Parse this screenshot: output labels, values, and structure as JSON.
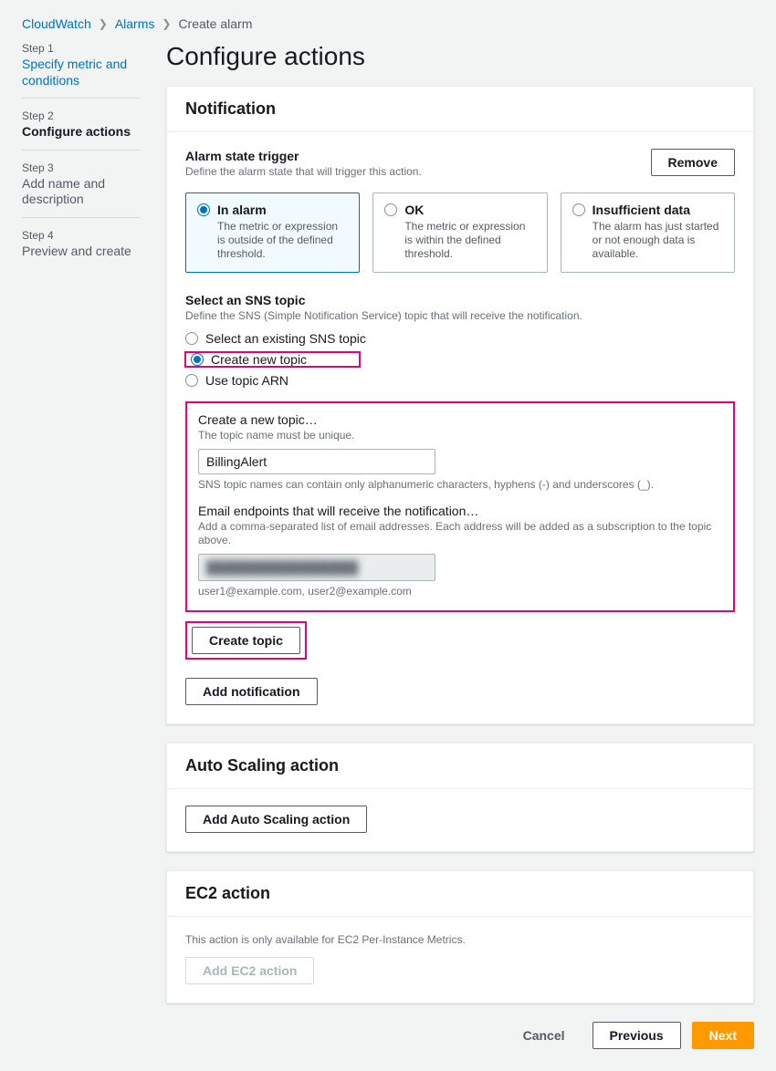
{
  "breadcrumbs": {
    "items": [
      "CloudWatch",
      "Alarms"
    ],
    "current": "Create alarm"
  },
  "sidebar": {
    "steps": [
      {
        "num": "Step 1",
        "name": "Specify metric and conditions"
      },
      {
        "num": "Step 2",
        "name": "Configure actions"
      },
      {
        "num": "Step 3",
        "name": "Add name and description"
      },
      {
        "num": "Step 4",
        "name": "Preview and create"
      }
    ]
  },
  "page": {
    "title": "Configure actions"
  },
  "notification": {
    "title": "Notification",
    "remove_label": "Remove",
    "trigger": {
      "title": "Alarm state trigger",
      "help": "Define the alarm state that will trigger this action.",
      "options": [
        {
          "label": "In alarm",
          "desc": "The metric or expression is outside of the defined threshold."
        },
        {
          "label": "OK",
          "desc": "The metric or expression is within the defined threshold."
        },
        {
          "label": "Insufficient data",
          "desc": "The alarm has just started or not enough data is available."
        }
      ]
    },
    "sns": {
      "title": "Select an SNS topic",
      "help": "Define the SNS (Simple Notification Service) topic that will receive the notification.",
      "options": [
        "Select an existing SNS topic",
        "Create new topic",
        "Use topic ARN"
      ]
    },
    "create_topic": {
      "title": "Create a new topic…",
      "help": "The topic name must be unique.",
      "value": "BillingAlert",
      "hint": "SNS topic names can contain only alphanumeric characters, hyphens (-) and underscores (_).",
      "email_title": "Email endpoints that will receive the notification…",
      "email_help": "Add a comma-separated list of email addresses. Each address will be added as a subscription to the topic above.",
      "email_value": "████████████████",
      "email_example": "user1@example.com, user2@example.com",
      "button": "Create topic"
    },
    "add_notification": "Add notification"
  },
  "auto_scaling": {
    "title": "Auto Scaling action",
    "button": "Add Auto Scaling action"
  },
  "ec2": {
    "title": "EC2 action",
    "help": "This action is only available for EC2 Per-Instance Metrics.",
    "button": "Add EC2 action"
  },
  "footer": {
    "cancel": "Cancel",
    "previous": "Previous",
    "next": "Next"
  }
}
